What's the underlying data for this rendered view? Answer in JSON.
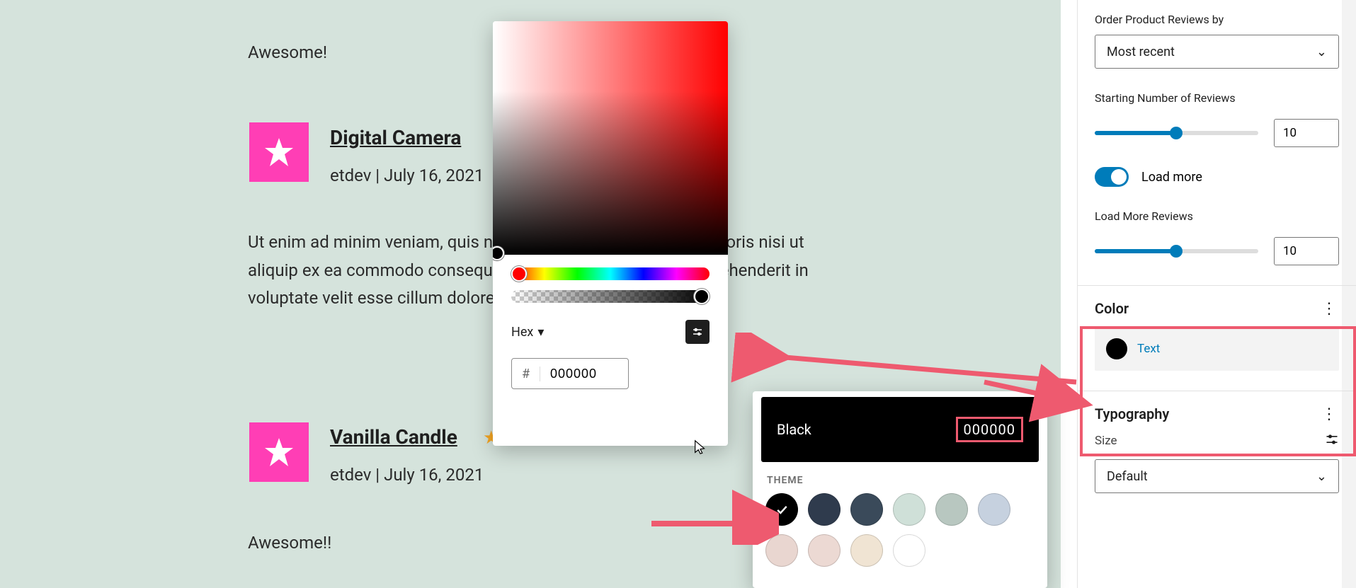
{
  "reviews": [
    {
      "body": "Awesome!"
    },
    {
      "product": "Digital Camera",
      "author": "etdev",
      "date": "July 16, 2021",
      "body": "Ut enim ad minim veniam, quis nostrud exercitation ullamco laboris nisi ut aliquip ex ea commodo consequat. Duis aute irure dolor in reprehenderit in voluptate velit esse cillum dolore eu fugiat nulla pariatur."
    },
    {
      "product": "Vanilla Candle",
      "author": "etdev",
      "date": "July 16, 2021",
      "body": "Awesome!!"
    }
  ],
  "picker": {
    "format_label": "Hex",
    "hash": "#",
    "hex_value": "000000"
  },
  "swatches": {
    "name": "Black",
    "hex": "000000",
    "section_label": "THEME",
    "row1": [
      "#000000",
      "#2f3b4d",
      "#3a4a5a",
      "#cfe0d8",
      "#b8c7c0",
      "#c6d1df"
    ],
    "row2": [
      "#e9d6d0",
      "#ecd9d3",
      "#f0e4d3",
      "#ffffff"
    ]
  },
  "sidebar": {
    "order_label": "Order Product Reviews by",
    "order_value": "Most recent",
    "starting_label": "Starting Number of Reviews",
    "starting_value": "10",
    "load_more_label": "Load more",
    "load_more_reviews_label": "Load More Reviews",
    "load_more_reviews_value": "10",
    "color_heading": "Color",
    "color_text_label": "Text",
    "typography_heading": "Typography",
    "size_label": "Size",
    "size_value": "Default"
  }
}
